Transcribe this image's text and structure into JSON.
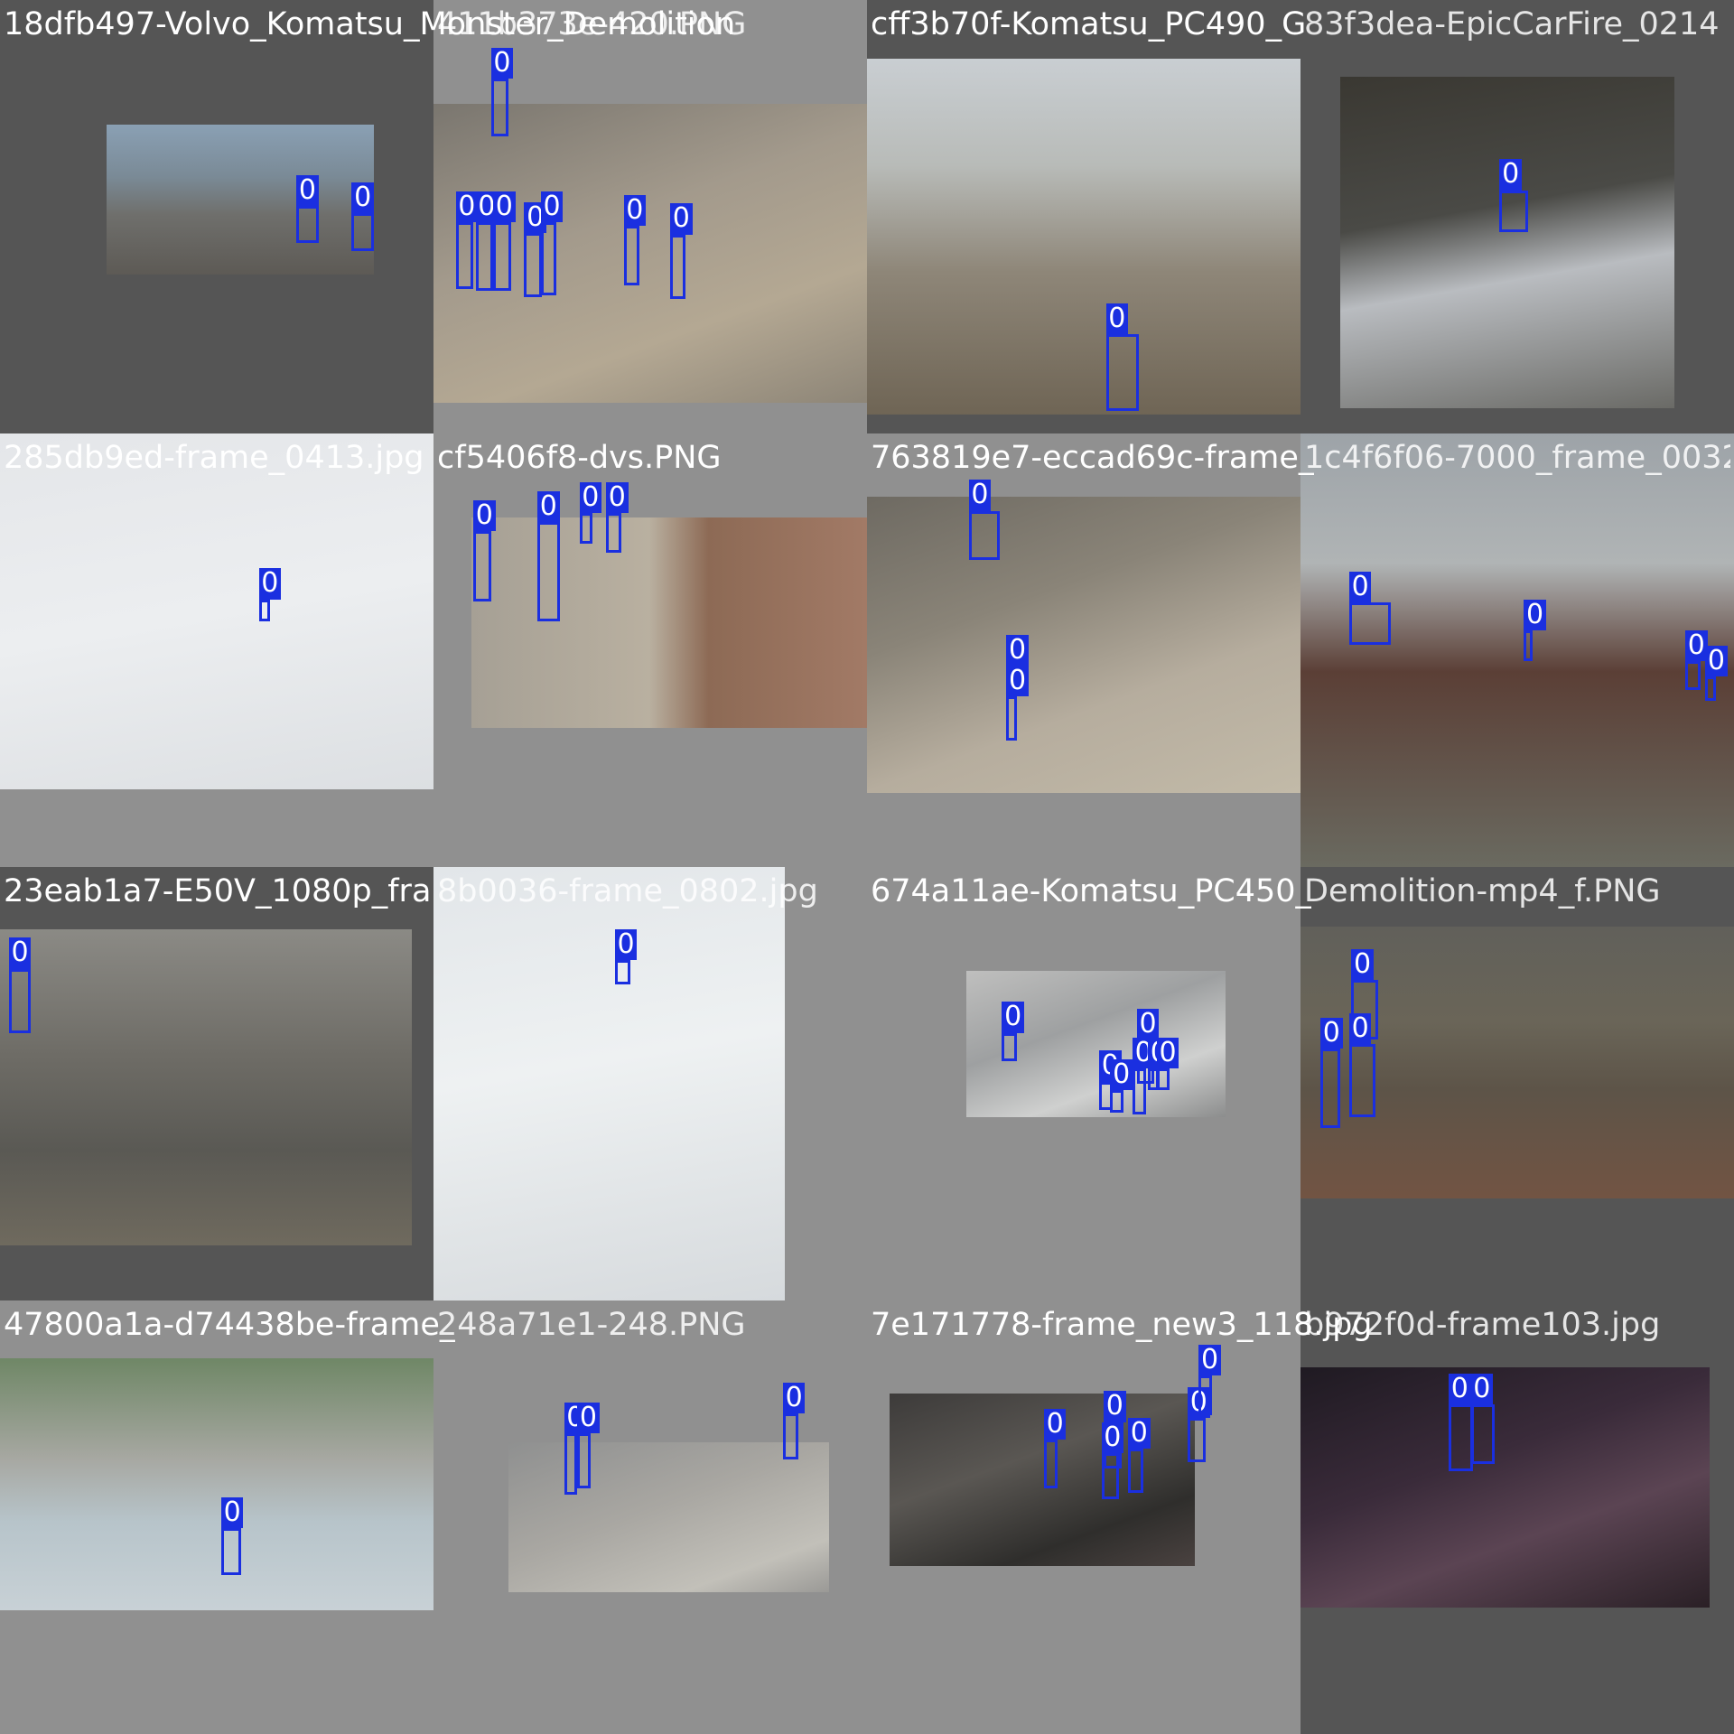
{
  "tiles": [
    {
      "filename": "18dfb497-Volvo_Komatsu_Monster_Demolition",
      "overlap": "411b373e-420.PNG"
    },
    {
      "filename": "",
      "overlap": ""
    },
    {
      "filename": "cff3b70f-Komatsu_PC490_G",
      "overlap": "83f3dea-EpicCarFire_0214"
    },
    {
      "filename": "",
      "overlap": ""
    },
    {
      "filename": "285db9ed-frame_0413.jpg",
      "overlap": ""
    },
    {
      "filename": "cf5406f8-dvs.PNG",
      "overlap": ""
    },
    {
      "filename": "763819e7-eccad69c-frame_",
      "overlap": "1c4f6f06-7000_frame_0032"
    },
    {
      "filename": "",
      "overlap": ""
    },
    {
      "filename": "23eab1a7-E50V_1080p_fra",
      "overlap": "8b0036-frame_0802.jpg"
    },
    {
      "filename": "",
      "overlap": ""
    },
    {
      "filename": "674a11ae-Komatsu_PC450_",
      "overlap": "Demolition-mp4_f.PNG"
    },
    {
      "filename": "",
      "overlap": ""
    },
    {
      "filename": "47800a1a-d74438be-frame_",
      "overlap": "248a71e1-248.PNG"
    },
    {
      "filename": "",
      "overlap": ""
    },
    {
      "filename": "7e171778-frame_new3_118.jpg",
      "overlap": "b972f0d-frame103.jpg"
    },
    {
      "filename": "",
      "overlap": ""
    }
  ],
  "class_label": "0",
  "colors": {
    "box": "#1a2fe0",
    "dark_pad": "#555555",
    "light_pad": "#909090",
    "label_text": "#ffffff"
  }
}
